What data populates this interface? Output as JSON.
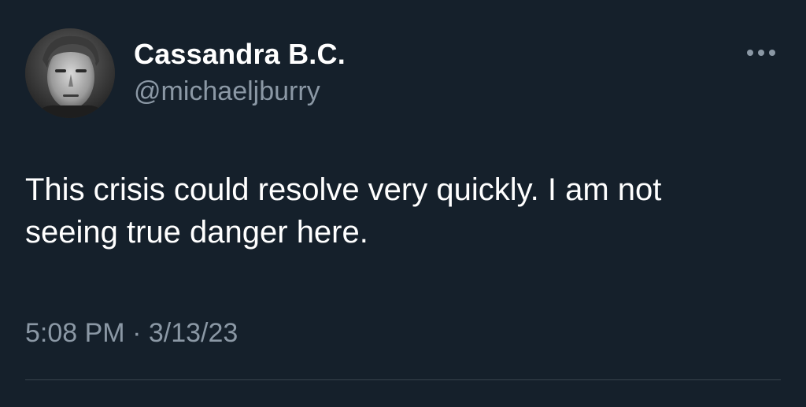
{
  "tweet": {
    "author": {
      "display_name": "Cassandra B.C.",
      "handle": "@michaeljburry"
    },
    "text": "This crisis could resolve very quickly. I am not\nseeing true danger here.",
    "timestamp": "5:08 PM · 3/13/23",
    "more_icon": "more-horizontal-icon"
  },
  "colors": {
    "background": "#15202b",
    "primary_text": "#ffffff",
    "secondary_text": "#8b98a5",
    "divider": "#38444d"
  }
}
